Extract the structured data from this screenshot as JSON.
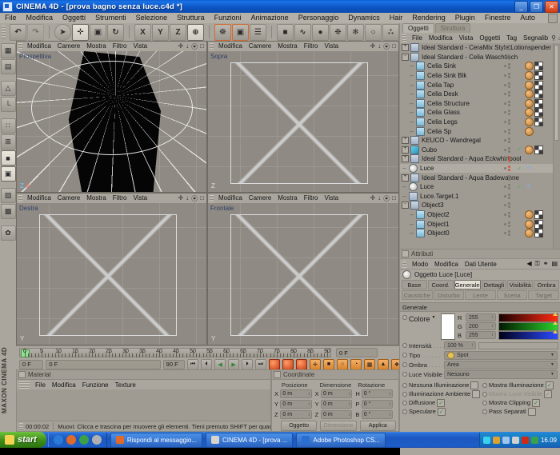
{
  "window": {
    "title": "CINEMA 4D - [prova bagno senza luce.c4d *]",
    "minimize": "_",
    "restore": "❐",
    "close": "✕"
  },
  "menubar": {
    "items": [
      "File",
      "Modifica",
      "Oggetti",
      "Strumenti",
      "Selezione",
      "Struttura",
      "Funzioni",
      "Animazione",
      "Personaggio",
      "Dynamics",
      "Hair",
      "Rendering",
      "Plugin",
      "Finestre",
      "Auto"
    ]
  },
  "toolbar": {
    "groups": [
      {
        "buttons": [
          {
            "name": "undo-button",
            "glyph": "↶",
            "state": "normal"
          },
          {
            "name": "redo-button",
            "glyph": "↷",
            "state": "disabled"
          }
        ]
      },
      {
        "buttons": [
          {
            "name": "select-tool-button",
            "glyph": "➤",
            "state": "circled"
          },
          {
            "name": "move-tool-button",
            "glyph": "✛",
            "state": "active"
          },
          {
            "name": "scale-tool-button",
            "glyph": "▣",
            "state": "normal"
          },
          {
            "name": "rotate-tool-button",
            "glyph": "↻",
            "state": "normal"
          }
        ]
      },
      {
        "buttons": [
          {
            "name": "lock-x-button",
            "glyph": "X",
            "state": "normal"
          },
          {
            "name": "lock-y-button",
            "glyph": "Y",
            "state": "normal"
          },
          {
            "name": "lock-z-button",
            "glyph": "Z",
            "state": "normal"
          },
          {
            "name": "world-coordinates-button",
            "glyph": "⊕",
            "state": "active"
          }
        ]
      },
      {
        "buttons": [
          {
            "name": "render-view-button",
            "glyph": "☸",
            "state": "highlight"
          },
          {
            "name": "render-region-button",
            "glyph": "▣",
            "state": "highlight"
          },
          {
            "name": "render-settings-button",
            "glyph": "☰",
            "state": "normal"
          }
        ]
      },
      {
        "buttons": [
          {
            "name": "primitive-cube-button",
            "glyph": "■",
            "state": "normal"
          },
          {
            "name": "spline-button",
            "glyph": "∿",
            "state": "normal"
          },
          {
            "name": "nurbs-button",
            "glyph": "●",
            "state": "normal"
          },
          {
            "name": "array-button",
            "glyph": "❉",
            "state": "normal"
          },
          {
            "name": "deformer-button",
            "glyph": "❄",
            "state": "normal"
          },
          {
            "name": "scene-object-button",
            "glyph": "○",
            "state": "normal"
          },
          {
            "name": "particles-button",
            "glyph": "∴",
            "state": "normal"
          }
        ]
      },
      {
        "buttons": [
          {
            "name": "help-cursor-button",
            "glyph": "?",
            "state": "normal"
          },
          {
            "name": "content-browser-button",
            "glyph": "▦",
            "state": "normal"
          }
        ]
      },
      {
        "buttons": [
          {
            "name": "sky-object-button",
            "glyph": "◉",
            "state": "highlight"
          }
        ]
      }
    ]
  },
  "left_toolbar": {
    "buttons": [
      {
        "name": "viewport-layout-button",
        "glyph": "▦"
      },
      {
        "name": "texture-axis-button",
        "glyph": "▤"
      },
      {
        "name": "model-mode-button",
        "glyph": "△"
      },
      {
        "name": "object-axis-button",
        "glyph": "└"
      },
      {
        "name": "point-mode-button",
        "glyph": "∷"
      },
      {
        "name": "edge-mode-button",
        "glyph": "⊞"
      },
      {
        "name": "polygon-mode-button",
        "glyph": "■",
        "active": true
      },
      {
        "name": "object-mode-button",
        "glyph": "▣",
        "active": true
      },
      {
        "name": "texture-mode-button",
        "glyph": "▨"
      },
      {
        "name": "uv-mode-button",
        "glyph": "▩"
      },
      {
        "name": "bubble-mode-button",
        "glyph": "✿"
      }
    ],
    "brand": "MAXON CINEMA 4D"
  },
  "viewports": {
    "menus": [
      "Modifica",
      "Camere",
      "Mostra",
      "Filtro",
      "Vista"
    ],
    "icons": [
      "move-view-icon",
      "scale-view-icon",
      "rotate-view-icon",
      "maximize-view-icon"
    ],
    "panels": [
      {
        "name": "viewport-perspective",
        "label": "Prospettiva",
        "axis": "Z  X"
      },
      {
        "name": "viewport-top",
        "label": "Sopra",
        "axis": "Z"
      },
      {
        "name": "viewport-right",
        "label": "Destra",
        "axis": "Y"
      },
      {
        "name": "viewport-front",
        "label": "Frontale",
        "axis": "Y"
      }
    ]
  },
  "timeline": {
    "ticks": [
      0,
      5,
      10,
      15,
      20,
      25,
      30,
      35,
      40,
      45,
      50,
      55,
      60,
      65,
      70,
      75,
      80,
      85,
      90
    ],
    "current_frame_field": "0 F",
    "end_frame_right": "0 F",
    "start_field": "0 F",
    "preview_field": "0 F",
    "length_field": "90 F",
    "loop_label": "90 F",
    "transport": [
      {
        "name": "go-to-start-button",
        "glyph": "⏮"
      },
      {
        "name": "previous-frame-button",
        "glyph": "⏴"
      },
      {
        "name": "play-reverse-button",
        "glyph": "◀"
      },
      {
        "name": "play-forward-button",
        "glyph": "▶"
      },
      {
        "name": "next-frame-button",
        "glyph": "⏵"
      },
      {
        "name": "go-to-end-button",
        "glyph": "⏭"
      }
    ],
    "record_buttons": [
      {
        "name": "record-position-button",
        "glyph": "◉"
      },
      {
        "name": "record-active-button",
        "glyph": "●"
      },
      {
        "name": "autokey-button",
        "glyph": "◎"
      }
    ],
    "key_buttons": [
      {
        "name": "key-position-button",
        "glyph": "✛"
      },
      {
        "name": "key-scale-button",
        "glyph": "■"
      },
      {
        "name": "key-rotation-button",
        "glyph": "○"
      },
      {
        "name": "key-parameter-button",
        "glyph": "◔"
      },
      {
        "name": "key-pla-button",
        "glyph": "▦"
      },
      {
        "name": "key-toggle-button",
        "glyph": "▲"
      },
      {
        "name": "key-options-button",
        "glyph": "❖"
      }
    ]
  },
  "materials": {
    "title": "Material",
    "menus": [
      "File",
      "Modifica",
      "Funzione",
      "Texture"
    ]
  },
  "statusbar": {
    "time": "00:00:02",
    "message": "Muovi: Clicca e trascina per muovere gli elementi. Tieni premuto SHIFT per quantificare il movimento / aggiungere alla selezione in modo punto, CTRL per rimuovere."
  },
  "coordinates": {
    "title": "Coordinate",
    "headers": [
      "Posizione",
      "Dimensione",
      "Rotazione"
    ],
    "rows": [
      {
        "pos_label": "X",
        "pos": "0 m",
        "size_label": "X",
        "size": "0 m",
        "rot_label": "H",
        "rot": "0 °"
      },
      {
        "pos_label": "Y",
        "pos": "0 m",
        "size_label": "Y",
        "size": "0 m",
        "rot_label": "P",
        "rot": "0 °"
      },
      {
        "pos_label": "Z",
        "pos": "0 m",
        "size_label": "Z",
        "size": "0 m",
        "rot_label": "B",
        "rot": "0 °"
      }
    ],
    "buttons": [
      "Oggetto",
      "Dimensione",
      "Applica"
    ]
  },
  "object_manager": {
    "tabs": [
      {
        "label": "Oggetti",
        "active": true
      },
      {
        "label": "Struttura",
        "active": false
      }
    ],
    "menus": [
      "File",
      "Modifica",
      "Vista",
      "Oggetti",
      "Tag",
      "Segnalib"
    ],
    "icons": [
      "search-icon",
      "home-icon",
      "collapse-icon",
      "options-icon"
    ],
    "rows": [
      {
        "name": "Ideal Standard - CeraMix Style Lotionspender",
        "indent": 0,
        "expander": "+",
        "icon": "group",
        "tags": [],
        "selected": false
      },
      {
        "name": "Ideal Standard - Celia Waschtisch",
        "indent": 0,
        "expander": "-",
        "icon": "group",
        "tags": [],
        "selected": false
      },
      {
        "name": "Celia Sink",
        "indent": 1,
        "expander": "",
        "icon": "poly",
        "tags": [
          "material",
          "texture"
        ],
        "selected": false
      },
      {
        "name": "Celia Sink Blk",
        "indent": 1,
        "expander": "",
        "icon": "poly",
        "tags": [
          "material",
          "texture"
        ],
        "selected": false
      },
      {
        "name": "Celia Tap",
        "indent": 1,
        "expander": "",
        "icon": "poly",
        "tags": [
          "material",
          "texture"
        ],
        "selected": false
      },
      {
        "name": "Celia Desk",
        "indent": 1,
        "expander": "",
        "icon": "poly",
        "tags": [
          "material",
          "texture"
        ],
        "selected": false
      },
      {
        "name": "Celia Structure",
        "indent": 1,
        "expander": "",
        "icon": "poly",
        "tags": [
          "material",
          "texture"
        ],
        "selected": false
      },
      {
        "name": "Celia Glass",
        "indent": 1,
        "expander": "",
        "icon": "poly",
        "tags": [
          "material",
          "texture"
        ],
        "selected": false
      },
      {
        "name": "Celia Legs",
        "indent": 1,
        "expander": "",
        "icon": "poly",
        "tags": [
          "material",
          "texture"
        ],
        "selected": false
      },
      {
        "name": "Celia Sp",
        "indent": 1,
        "expander": "",
        "icon": "poly",
        "tags": [
          "material"
        ],
        "selected": false
      },
      {
        "name": "KEUCO - Wandregal",
        "indent": 0,
        "expander": "+",
        "icon": "group",
        "tags": [],
        "selected": false
      },
      {
        "name": "Cubo",
        "indent": 0,
        "expander": "+",
        "icon": "cube",
        "tags": [
          "check",
          "material",
          "texture"
        ],
        "selected": false
      },
      {
        "name": "Ideal Standard - Aqua Eckwhirlpool",
        "indent": 0,
        "expander": "+",
        "icon": "group",
        "tags": [
          "red"
        ],
        "selected": false
      },
      {
        "name": "Luce",
        "indent": 0,
        "expander": "",
        "icon": "light",
        "tags": [
          "red",
          "check",
          "star"
        ],
        "selected": true
      },
      {
        "name": "Ideal Standard - Aqua Badewanne",
        "indent": 0,
        "expander": "+",
        "icon": "group",
        "tags": [],
        "selected": false
      },
      {
        "name": "Luce",
        "indent": 0,
        "expander": "",
        "icon": "light",
        "tags": [
          "check",
          "star"
        ],
        "selected": false
      },
      {
        "name": "Luce.Target.1",
        "indent": 0,
        "expander": "",
        "icon": "group",
        "tags": [],
        "selected": false
      },
      {
        "name": "Object3",
        "indent": 0,
        "expander": "-",
        "icon": "group",
        "tags": [],
        "selected": false
      },
      {
        "name": "Object2",
        "indent": 1,
        "expander": "",
        "icon": "poly",
        "tags": [
          "material",
          "texture"
        ],
        "selected": false
      },
      {
        "name": "Object1",
        "indent": 1,
        "expander": "",
        "icon": "poly",
        "tags": [
          "material",
          "texture"
        ],
        "selected": false
      },
      {
        "name": "Object0",
        "indent": 1,
        "expander": "",
        "icon": "poly",
        "tags": [
          "material",
          "texture"
        ],
        "selected": false
      }
    ]
  },
  "attributes": {
    "title": "Attributi",
    "menus": [
      "Modo",
      "Modifica",
      "Dati Utente"
    ],
    "right_icons": [
      "back-arrow-icon",
      "lock-icon",
      "link-icon",
      "options-icon"
    ],
    "object_header": "Oggetto Luce [Luce]",
    "tabs_row1": [
      {
        "label": "Base",
        "active": false
      },
      {
        "label": "Coord.",
        "active": false
      },
      {
        "label": "Generale",
        "active": true
      },
      {
        "label": "Dettagli",
        "active": false
      },
      {
        "label": "Visibilità",
        "active": false
      },
      {
        "label": "Ombra",
        "active": false
      }
    ],
    "tabs_row2": [
      {
        "label": "Caustiche",
        "active": false
      },
      {
        "label": "Disturbo",
        "active": false
      },
      {
        "label": "Lente",
        "active": false
      },
      {
        "label": "Scena",
        "active": false
      },
      {
        "label": "Target",
        "active": false
      }
    ],
    "section_title": "Generale",
    "color": {
      "label": "Colore",
      "swatch_hex": "#ffffff",
      "channels": [
        {
          "label": "R",
          "value": "255"
        },
        {
          "label": "G",
          "value": "200"
        },
        {
          "label": "B",
          "value": "255"
        }
      ]
    },
    "intensity": {
      "label": "Intensità",
      "value": "100 %"
    },
    "type": {
      "label": "Tipo",
      "value": "Spot"
    },
    "shadow": {
      "label": "Ombra",
      "value": "Area"
    },
    "visible_light": {
      "label": "Luce Visibile",
      "value": "Nessuno"
    },
    "checkboxes_left": [
      {
        "label": "Nessuna Illuminazione",
        "checked": false,
        "dim": false
      },
      {
        "label": "Illuminazione Ambiente",
        "checked": false,
        "dim": false
      },
      {
        "label": "Diffusione",
        "checked": true,
        "dim": false
      },
      {
        "label": "Speculare",
        "checked": true,
        "dim": false
      }
    ],
    "checkboxes_right": [
      {
        "label": "Mostra Illuminazione",
        "checked": true,
        "dim": false
      },
      {
        "label": "Mostra Luce Visibile",
        "checked": true,
        "dim": true
      },
      {
        "label": "Mostra Clipping",
        "checked": true,
        "dim": false
      },
      {
        "label": "Pass Separati",
        "checked": false,
        "dim": false
      }
    ]
  },
  "taskbar": {
    "start_label": "start",
    "quick_launch": [
      "browser-icon",
      "mail-icon",
      "media-icon",
      "more-icon"
    ],
    "items": [
      {
        "label": "Rispondi al messaggio...",
        "icon_color": "#e06a2a"
      },
      {
        "label": "CINEMA 4D - [prova ...",
        "icon_color": "#d8d4cb"
      },
      {
        "label": "Adobe Photoshop CS...",
        "icon_color": "#2a6fd0"
      }
    ],
    "clock": "16.09",
    "tray_icons": [
      "shield-icon",
      "network-icon",
      "volume-icon",
      "sound-icon",
      "antivirus-icon",
      "update-icon"
    ]
  }
}
